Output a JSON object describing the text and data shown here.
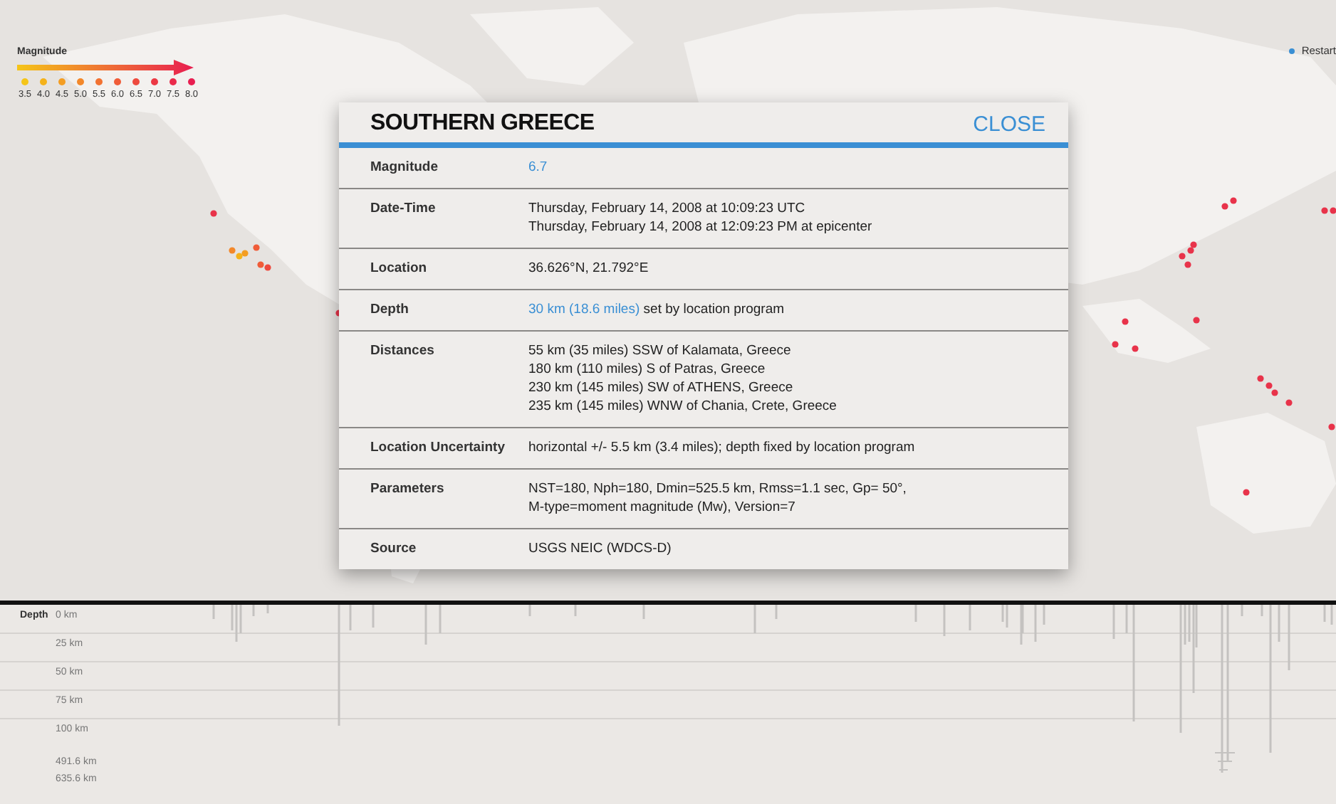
{
  "legend": {
    "title": "Magnitude",
    "items": [
      {
        "label": "3.5",
        "color": "#f5c518"
      },
      {
        "label": "4.0",
        "color": "#f5b21a"
      },
      {
        "label": "4.5",
        "color": "#f49d22"
      },
      {
        "label": "5.0",
        "color": "#f3882a"
      },
      {
        "label": "5.5",
        "color": "#f27232"
      },
      {
        "label": "6.0",
        "color": "#f05c38"
      },
      {
        "label": "6.5",
        "color": "#ee4a3e"
      },
      {
        "label": "7.0",
        "color": "#ec3844"
      },
      {
        "label": "7.5",
        "color": "#ea2a4a"
      },
      {
        "label": "8.0",
        "color": "#e81e50"
      }
    ]
  },
  "restart": {
    "label": "Restart"
  },
  "detail": {
    "title": "SOUTHERN GREECE",
    "close": "CLOSE",
    "rows": [
      {
        "label": "Magnitude",
        "lines": [
          [
            {
              "text": "6.7",
              "link": true
            }
          ]
        ]
      },
      {
        "label": "Date-Time",
        "lines": [
          [
            {
              "text": "Thursday, February 14, 2008 at 10:09:23 UTC",
              "link": false
            }
          ],
          [
            {
              "text": "Thursday, February 14, 2008 at 12:09:23 PM at epicenter",
              "link": false
            }
          ]
        ]
      },
      {
        "label": "Location",
        "lines": [
          [
            {
              "text": "36.626°N, 21.792°E",
              "link": false
            }
          ]
        ]
      },
      {
        "label": "Depth",
        "lines": [
          [
            {
              "text": "30 km (18.6 miles)",
              "link": true
            },
            {
              "text": " set by location program",
              "link": false
            }
          ]
        ]
      },
      {
        "label": "Distances",
        "lines": [
          [
            {
              "text": "55 km (35 miles) SSW of Kalamata, Greece",
              "link": false
            }
          ],
          [
            {
              "text": "180 km (110 miles) S of Patras, Greece",
              "link": false
            }
          ],
          [
            {
              "text": "230 km (145 miles) SW of ATHENS, Greece",
              "link": false
            }
          ],
          [
            {
              "text": "235 km (145 miles) WNW of Chania, Crete, Greece",
              "link": false
            }
          ]
        ]
      },
      {
        "label": "Location Uncertainty",
        "lines": [
          [
            {
              "text": "horizontal +/- 5.5 km (3.4 miles); depth fixed by location program",
              "link": false
            }
          ]
        ]
      },
      {
        "label": "Parameters",
        "lines": [
          [
            {
              "text": "NST=180, Nph=180, Dmin=525.5 km, Rmss=1.1 sec, Gp= 50°,",
              "link": false
            }
          ],
          [
            {
              "text": "M-type=moment magnitude (Mw), Version=7",
              "link": false
            }
          ]
        ]
      },
      {
        "label": "Source",
        "lines": [
          [
            {
              "text": "USGS NEIC (WDCS-D)",
              "link": false
            }
          ]
        ]
      }
    ]
  },
  "depth_panel": {
    "title": "Depth",
    "levels": [
      "0 km",
      "25 km",
      "50 km",
      "75 km",
      "100 km",
      "491.6 km",
      "635.6 km"
    ]
  }
}
